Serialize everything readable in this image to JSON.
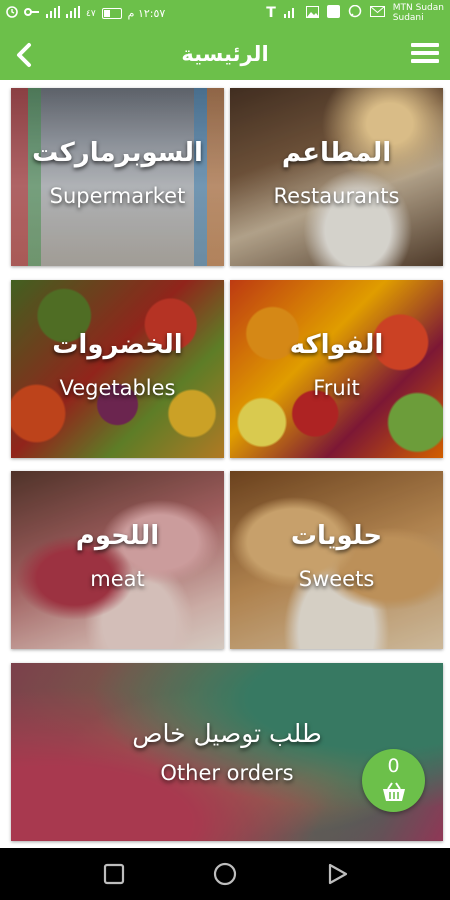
{
  "status_bar": {
    "time": "١٢:٥٧ م",
    "speed": "٤٧\nب/ث",
    "carrier_line1": "MTN Sudan",
    "carrier_line2": "Sudani"
  },
  "app_bar": {
    "title": "الرئيسية"
  },
  "categories": [
    {
      "ar": "المطاعم",
      "en": "Restaurants"
    },
    {
      "ar": "السوبرماركت",
      "en": "Supermarket"
    },
    {
      "ar": "الفواكه",
      "en": "Fruit"
    },
    {
      "ar": "الخضروات",
      "en": "Vegetables"
    },
    {
      "ar": "حلويات",
      "en": "Sweets"
    },
    {
      "ar": "اللحوم",
      "en": "meat"
    }
  ],
  "special_order": {
    "ar": "طلب توصيل خاص",
    "en": "Other orders"
  },
  "cart": {
    "count": "0"
  },
  "colors": {
    "primary": "#6cc04a",
    "nav": "#000000"
  }
}
